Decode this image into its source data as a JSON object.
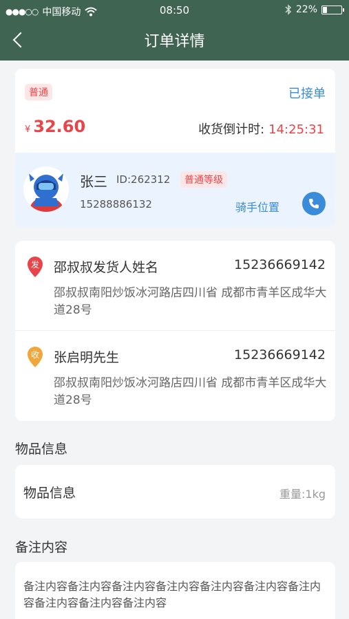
{
  "status_bar": {
    "carrier": "中国移动",
    "time": "08:50",
    "battery": "22%",
    "battery_level": 0.22
  },
  "header": {
    "title": "订单详情"
  },
  "order": {
    "tag": "普通",
    "status": "已接单",
    "currency": "¥",
    "price": "32.60",
    "countdown_label": "收货倒计时:",
    "countdown_value": "14:25:31"
  },
  "rider": {
    "name": "张三",
    "id": "ID:262312",
    "level": "普通等级",
    "phone": "15288886132",
    "location_link": "骑手位置"
  },
  "sender": {
    "badge": "发",
    "name": "邵叔叔发货人姓名",
    "phone": "15236669142",
    "address": "邵叔叔南阳炒饭冰河路店四川省 成都市青羊区成华大道28号"
  },
  "receiver": {
    "badge": "收",
    "name": "张启明先生",
    "phone": "15236669142",
    "address": "邵叔叔南阳炒饭冰河路店四川省 成都市青羊区成华大道28号"
  },
  "goods": {
    "section_title": "物品信息",
    "label": "物品信息",
    "weight": "重量:1kg"
  },
  "remark": {
    "section_title": "备注内容",
    "text": "备注内容备注内容备注内容备注内容备注内容备注内容备注内容备注内容备注内容备注内容"
  },
  "colors": {
    "header_bg": "#3f6452",
    "accent_blue": "#3a8bd9",
    "accent_red": "#e8454a",
    "pin_sender": "#e8454a",
    "pin_receiver": "#f0a63a"
  }
}
